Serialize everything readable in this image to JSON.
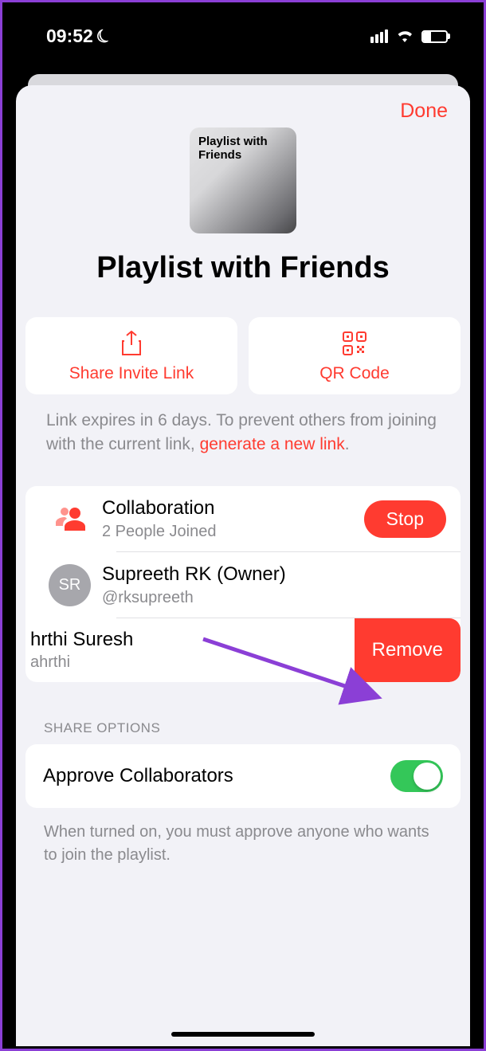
{
  "status": {
    "time": "09:52"
  },
  "header": {
    "done": "Done"
  },
  "playlist": {
    "artwork_text": "Playlist with Friends",
    "title": "Playlist with Friends"
  },
  "actions": {
    "share": "Share Invite Link",
    "qr": "QR Code"
  },
  "expire": {
    "text_a": "Link expires in 6 days. To prevent others from joining with the current link, ",
    "link": "generate a new link",
    "text_b": "."
  },
  "collab": {
    "title": "Collaboration",
    "sub": "2 People Joined",
    "stop": "Stop"
  },
  "owner": {
    "initials": "SR",
    "name": "Supreeth RK (Owner)",
    "handle": "@rksupreeth"
  },
  "swipe": {
    "name": "hrthi Suresh",
    "handle": "ahrthi",
    "remove": "Remove"
  },
  "options": {
    "section": "SHARE OPTIONS",
    "approve": "Approve Collaborators"
  },
  "footnote": "When turned on, you must approve anyone who wants to join the playlist."
}
